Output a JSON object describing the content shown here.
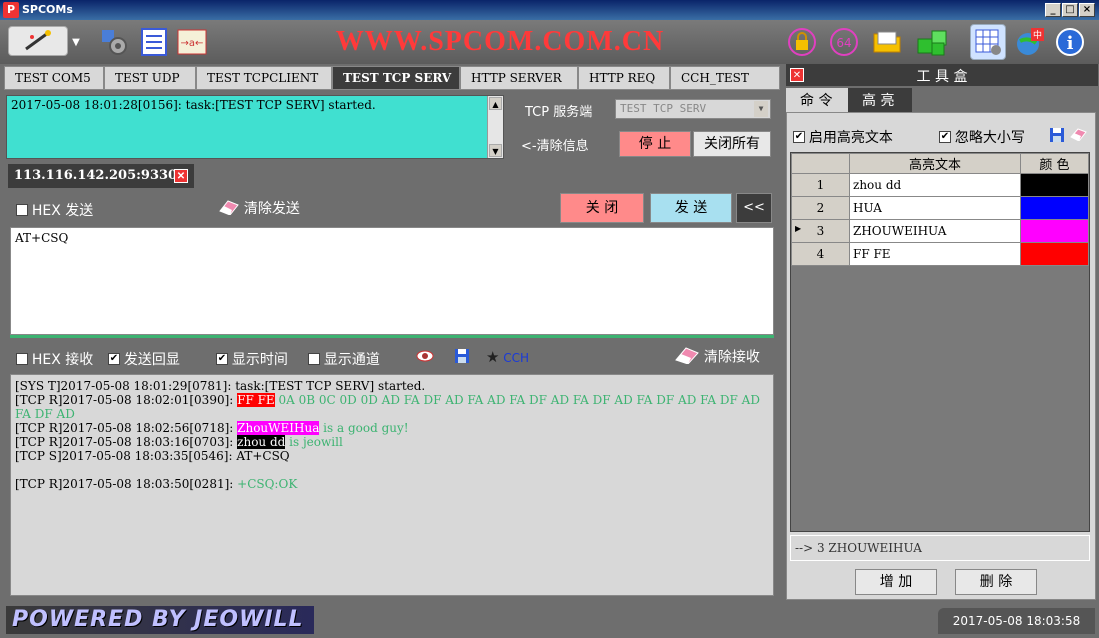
{
  "window": {
    "title": "SPCOMs",
    "app_icon": "P"
  },
  "toolbar": {
    "banner": "WWW.SPCOM.COM.CN"
  },
  "tabs": [
    {
      "label": "TEST COM5"
    },
    {
      "label": "TEST UDP"
    },
    {
      "label": "TEST TCPCLIENT"
    },
    {
      "label": "TEST TCP SERV"
    },
    {
      "label": "HTTP SERVER"
    },
    {
      "label": "HTTP REQ"
    },
    {
      "label": "CCH_TEST"
    }
  ],
  "server_log": {
    "line": "2017-05-08 18:01:28[0156]: task:[TEST TCP SERV] started."
  },
  "server_panel": {
    "type_label": "TCP 服务端",
    "select_value": "TEST TCP SERV",
    "clear_info": "<-清除信息",
    "stop_label": "停 止",
    "close_all_label": "关闭所有"
  },
  "connection": {
    "address": "113.116.142.205:9330"
  },
  "send_bar": {
    "hex_send": "HEX 发送",
    "clear_send": "清除发送",
    "close_label": "关 闭",
    "send_label": "发 送",
    "collapse_label": "<<"
  },
  "send_box": {
    "value": "AT+CSQ"
  },
  "recv_bar": {
    "hex_recv": "HEX 接收",
    "echo": "发送回显",
    "show_time": "显示时间",
    "show_channel": "显示通道",
    "cch": "CCH",
    "clear_recv": "清除接收"
  },
  "recv_log": {
    "l1": "[SYS T]2017-05-08 18:01:29[0781]: task:[TEST TCP SERV] started.",
    "l2_prefix": "[TCP R]2017-05-08 18:02:01[0390]: ",
    "l2_hl": "FF FE",
    "l2_rest": " 0A 0B 0C 0D 0D AD FA DF AD FA AD FA DF AD FA DF AD FA DF AD FA DF AD FA DF AD",
    "l3_prefix": "[TCP R]2017-05-08 18:02:56[0718]: ",
    "l3_hl": "ZhouWEIHua",
    "l3_rest": " is a good guy!",
    "l4_prefix": "[TCP R]2017-05-08 18:03:16[0703]: ",
    "l4_hl": "zhou dd",
    "l4_rest": " is jeowill",
    "l5": "[TCP S]2017-05-08 18:03:35[0546]: AT+CSQ",
    "l6_prefix": "[TCP R]2017-05-08 18:03:50[0281]: ",
    "l6_rest": "+CSQ:OK"
  },
  "toolbox": {
    "title": "工 具 盒",
    "tab_cmd": "命 令",
    "tab_hl": "高 亮",
    "enable_hl": "启用高亮文本",
    "ignore_case": "忽略大小写",
    "col_text": "高亮文本",
    "col_color": "颜 色",
    "rows": [
      {
        "idx": "1",
        "text": "zhou dd",
        "color": "#000000"
      },
      {
        "idx": "2",
        "text": "HUA",
        "color": "#0000ff"
      },
      {
        "idx": "3",
        "text": "ZHOUWEIHUA",
        "color": "#ff00ff"
      },
      {
        "idx": "4",
        "text": "FF FE",
        "color": "#ff0000"
      }
    ],
    "status": "--> 3 ZHOUWEIHUA",
    "add_label": "增 加",
    "delete_label": "删 除"
  },
  "footer": {
    "powered": "POWERED BY JEOWILL",
    "clock": "2017-05-08 18:03:58"
  }
}
